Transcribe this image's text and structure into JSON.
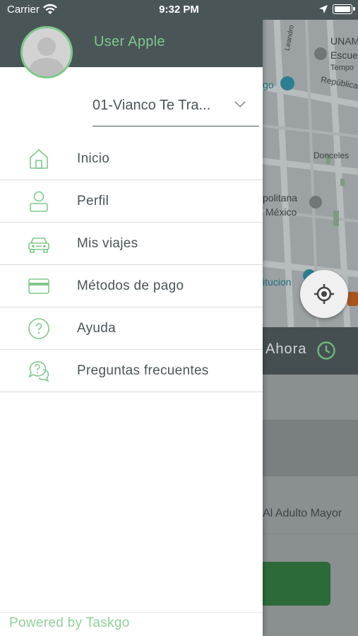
{
  "status_bar": {
    "carrier": "Carrier",
    "time": "9:32 PM"
  },
  "drawer": {
    "username": "User Apple",
    "company_select": {
      "value": "01-Vianco Te Tra..."
    },
    "menu": [
      {
        "label": "Inicio",
        "icon": "home-icon"
      },
      {
        "label": "Perfil",
        "icon": "user-icon"
      },
      {
        "label": "Mis viajes",
        "icon": "car-icon"
      },
      {
        "label": "Métodos de pago",
        "icon": "credit-card-icon"
      },
      {
        "label": "Ayuda",
        "icon": "help-icon"
      },
      {
        "label": "Preguntas frecuentes",
        "icon": "faq-chat-icon"
      }
    ],
    "footer": "Powered by Taskgo"
  },
  "background": {
    "map_labels": [
      "Leandro",
      "UNAM",
      "Escue",
      "Tempo",
      "República",
      "go",
      "Donceles",
      "politana",
      "México",
      "itucion"
    ],
    "bottom_bar_text": "Ahora",
    "row_text": "Al Adulto Mayor"
  },
  "colors": {
    "header": "#4a5558",
    "accent": "#7ec88a",
    "text": "#4a5558"
  }
}
